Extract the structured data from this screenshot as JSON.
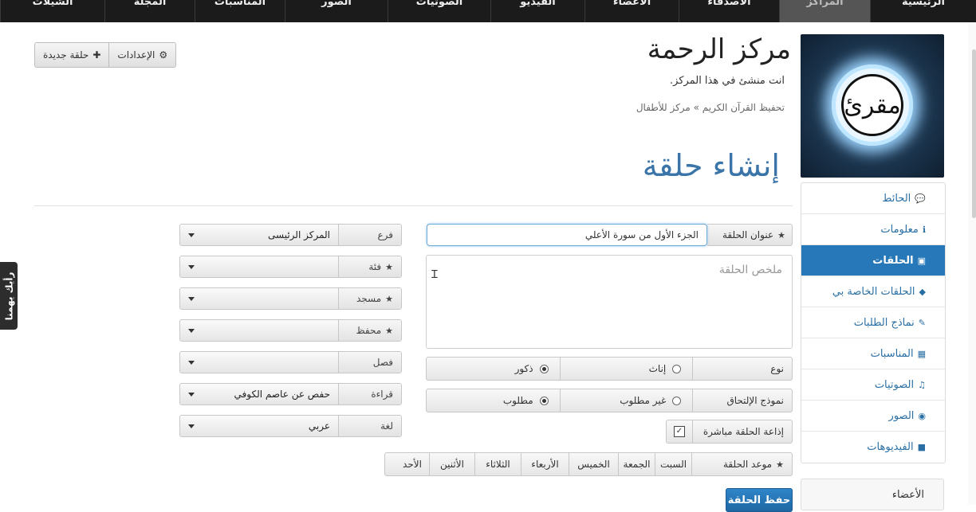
{
  "topnav": {
    "items": [
      {
        "label": "الرئيسية",
        "active": false
      },
      {
        "label": "المراكز",
        "active": true
      },
      {
        "label": "الأصدقاء",
        "active": false
      },
      {
        "label": "الأعضاء",
        "active": false
      },
      {
        "label": "الفيديو",
        "active": false
      },
      {
        "label": "الصوتيات",
        "active": false
      },
      {
        "label": "الصور",
        "active": false
      },
      {
        "label": "المناسبات",
        "active": false
      },
      {
        "label": "المجلة",
        "active": false
      },
      {
        "label": "الشيلات",
        "active": false
      }
    ]
  },
  "header": {
    "center_name": "مركز الرحمة",
    "subtitle": "انت منشئ في هذا المركز.",
    "breadcrumb": "تحفيظ القرآن الكريم » مركز للأطفال",
    "page_heading": "إنشاء حلقة"
  },
  "toolbar": {
    "settings_label": "الإعدادات",
    "new_circle_label": "حلقة جديدة"
  },
  "feedback": {
    "label": "رأيك يهمنا"
  },
  "logo": {
    "text": "مقرئ"
  },
  "sidebar": {
    "items": [
      {
        "label": "الحائط",
        "icon": "comments-icon",
        "glyph": "💬",
        "active": false
      },
      {
        "label": "معلومات",
        "icon": "info-icon",
        "glyph": "ℹ",
        "active": false
      },
      {
        "label": "الحلقات",
        "icon": "briefcase-icon",
        "glyph": "▣",
        "active": true
      },
      {
        "label": "الحلقات الخاصة بي",
        "icon": "tag-icon",
        "glyph": "◆",
        "active": false
      },
      {
        "label": "نماذج الطلبات",
        "icon": "pencil-icon",
        "glyph": "✎",
        "active": false
      },
      {
        "label": "المناسبات",
        "icon": "calendar-icon",
        "glyph": "▦",
        "active": false
      },
      {
        "label": "الصوتيات",
        "icon": "music-icon",
        "glyph": "♫",
        "active": false
      },
      {
        "label": "الصور",
        "icon": "camera-icon",
        "glyph": "◉",
        "active": false
      },
      {
        "label": "الفيديوهات",
        "icon": "video-icon",
        "glyph": "■",
        "active": false
      }
    ],
    "members_label": "الأعضاء"
  },
  "form": {
    "title_label": "عنوان الحلقة",
    "title_value": "الجزء الأول من سورة الأعلي",
    "summary_placeholder": "ملخص الحلقة",
    "type": {
      "label": "نوع",
      "options": [
        {
          "label": "ذكور",
          "checked": true
        },
        {
          "label": "إناث",
          "checked": false
        }
      ]
    },
    "join": {
      "label": "نموذج الإلتحاق",
      "options": [
        {
          "label": "مطلوب",
          "checked": true
        },
        {
          "label": "غير مطلوب",
          "checked": false
        }
      ]
    },
    "broadcast_label": "إذاعة الحلقة مباشرة",
    "broadcast_checked": true,
    "schedule_label": "موعد الحلقة",
    "days": [
      "السبت",
      "الجمعة",
      "الخميس",
      "الأربعاء",
      "الثلاثاء",
      "الأثنين",
      "الأحد"
    ],
    "save_label": "حفظ الحلقة",
    "selects": [
      {
        "label": "فرع",
        "starred": false,
        "value": "المركز الرئيسى"
      },
      {
        "label": "فئة",
        "starred": true,
        "value": ""
      },
      {
        "label": "مسجد",
        "starred": true,
        "value": ""
      },
      {
        "label": "محفظ",
        "starred": true,
        "value": ""
      },
      {
        "label": "فصل",
        "starred": false,
        "value": ""
      },
      {
        "label": "قراءة",
        "starred": false,
        "value": "حفص عن عاصم الكوفي"
      },
      {
        "label": "لغة",
        "starred": false,
        "value": "عربي"
      }
    ]
  }
}
